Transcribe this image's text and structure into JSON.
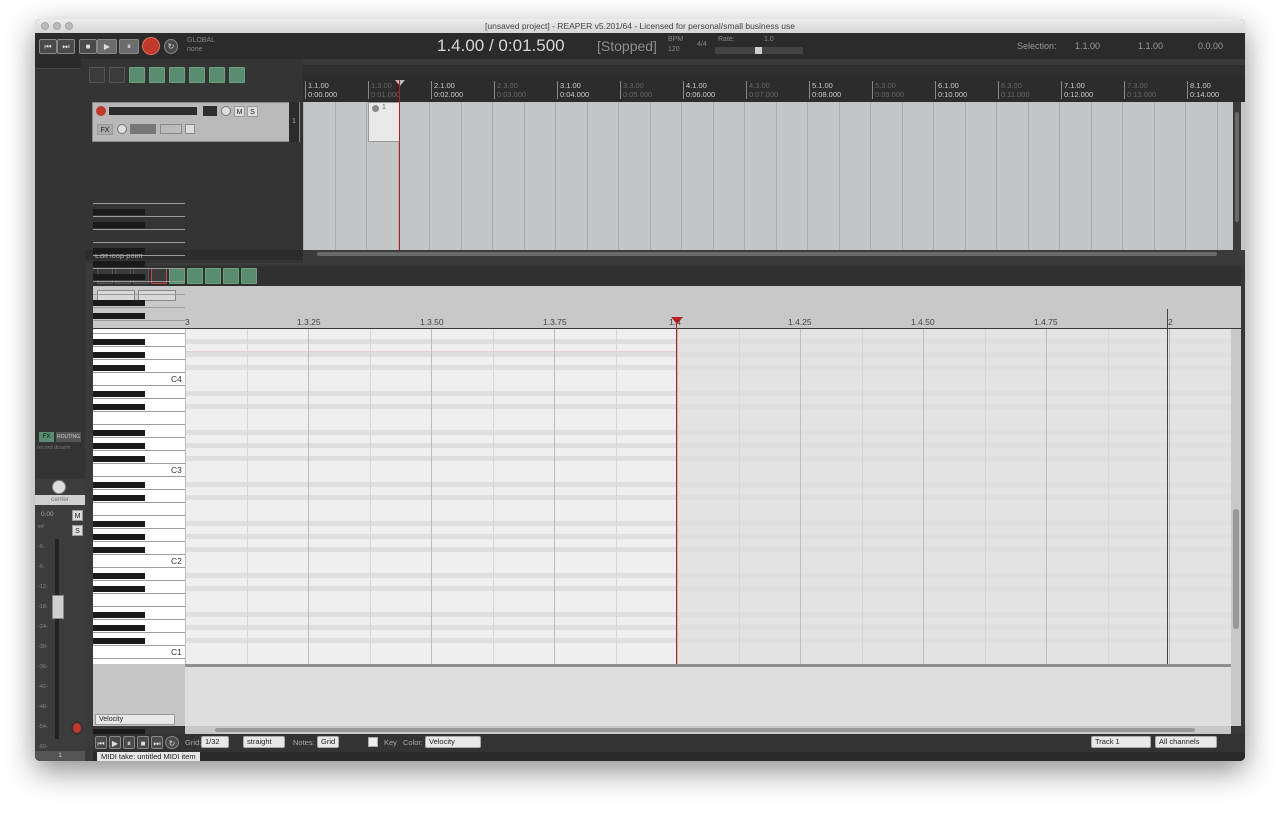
{
  "window": {
    "title": "[unsaved project] - REAPER v5.201/64 - Licensed for personal/small business use"
  },
  "transport": {
    "global_label": "GLOBAL",
    "global_value": "none",
    "position": "1.4.00 / 0:01.500",
    "status": "[Stopped]",
    "bpm_label": "BPM",
    "bpm_value": "120",
    "time_sig": "4/4",
    "rate_label": "Rate:",
    "rate_value": "1.0",
    "selection_label": "Selection:",
    "selection_start": "1.1.00",
    "selection_end": "1.1.00",
    "selection_length": "0.0.00"
  },
  "arrange_ruler": [
    {
      "bar": "1.1.00",
      "time": "0:00.000",
      "dim": false
    },
    {
      "bar": "1.3.00",
      "time": "0:01.000",
      "dim": true
    },
    {
      "bar": "2.1.00",
      "time": "0:02.000",
      "dim": false
    },
    {
      "bar": "2.3.00",
      "time": "0:03.000",
      "dim": true
    },
    {
      "bar": "3.1.00",
      "time": "0:04.000",
      "dim": false
    },
    {
      "bar": "3.3.00",
      "time": "0:05.000",
      "dim": true
    },
    {
      "bar": "4.1.00",
      "time": "0:06.000",
      "dim": false
    },
    {
      "bar": "4.3.00",
      "time": "0:07.000",
      "dim": true
    },
    {
      "bar": "5.1.00",
      "time": "0:08.000",
      "dim": false
    },
    {
      "bar": "5.3.00",
      "time": "0:09.000",
      "dim": true
    },
    {
      "bar": "6.1.00",
      "time": "0:10.000",
      "dim": false
    },
    {
      "bar": "6.3.00",
      "time": "0:11.000",
      "dim": true
    },
    {
      "bar": "7.1.00",
      "time": "0:12.000",
      "dim": false
    },
    {
      "bar": "7.3.00",
      "time": "0:13.000",
      "dim": true
    },
    {
      "bar": "8.1.00",
      "time": "0:14.000",
      "dim": false
    }
  ],
  "track": {
    "number": "1",
    "mute": "M",
    "solo": "S",
    "fx": "FX",
    "item_label": "1"
  },
  "hint_bar": "Edit loop point",
  "mixer": {
    "fx": "FX",
    "routing": "ROUTING",
    "record_disarm": "record disarm",
    "pan": "center",
    "volume": "0.00",
    "mute": "M",
    "solo": "S",
    "scale": [
      "inf",
      "-6-",
      "-6-",
      "-12-",
      "-18-",
      "-24-",
      "-30-",
      "-36-",
      "-42-",
      "-48-",
      "-54-",
      "-60-"
    ],
    "track_number": "1"
  },
  "midi_ruler": [
    {
      "label": "3"
    },
    {
      "label": "1.3.25"
    },
    {
      "label": "1.3.50"
    },
    {
      "label": "1.3.75"
    },
    {
      "label": "1.4"
    },
    {
      "label": "1.4.25"
    },
    {
      "label": "1.4.50"
    },
    {
      "label": "1.4.75"
    },
    {
      "label": "2"
    }
  ],
  "piano": {
    "octaves": [
      "C4",
      "C3",
      "C2",
      "C1"
    ]
  },
  "controls": {
    "cc_lane": "Velocity",
    "grid_label": "Grid:",
    "grid_value": "1/32",
    "swing_value": "straight",
    "notes_label": "Notes:",
    "notes_value": "Grid",
    "key_label": "Key",
    "color_label": "Color:",
    "color_value": "Velocity",
    "track_value": "Track 1",
    "channel_value": "All channels"
  },
  "status_bar": "MIDI take: untitled MIDI item",
  "colors": {
    "cursor": "#b32020",
    "accent_green": "#5a8d70",
    "record_red": "#c0392b"
  }
}
